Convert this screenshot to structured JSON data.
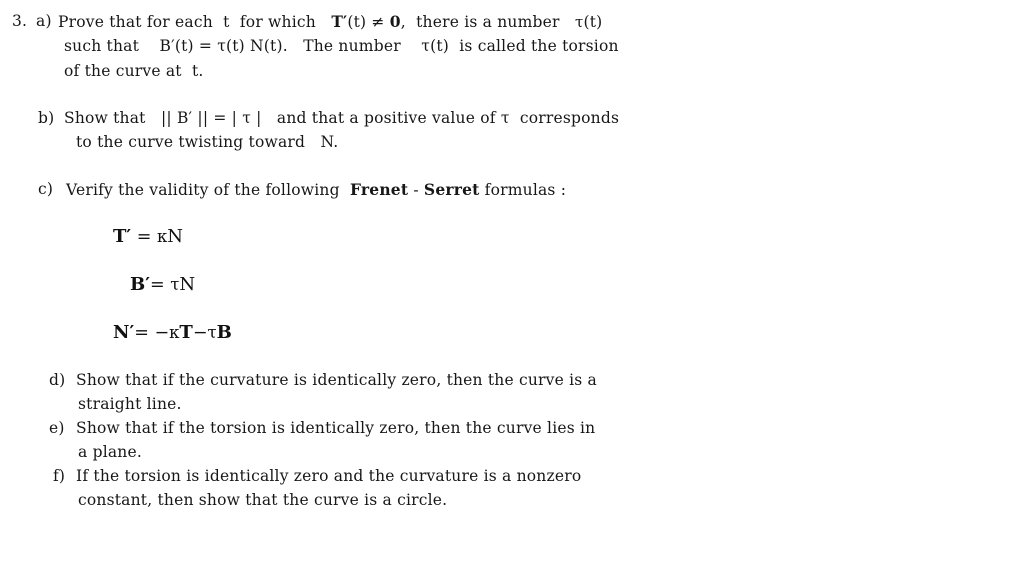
{
  "document": {
    "problem_number": "3.",
    "items": [
      {
        "label": "a)",
        "lines": [
          {
            "id": "a1",
            "segments": [
              {
                "t": "Prove that for each  t  for which   ",
                "style": "plain"
              },
              {
                "t": "T",
                "style": "bold"
              },
              {
                "t": "′",
                "style": "bold"
              },
              {
                "t": "(t) ≠ ",
                "style": "plain"
              },
              {
                "t": "0",
                "style": "bold"
              },
              {
                "t": ",  there is a number   ",
                "style": "plain"
              },
              {
                "t": "τ",
                "style": "greek"
              },
              {
                "t": "(t)",
                "style": "plain"
              }
            ],
            "text": "Prove that for each  t  for which   T′(t) ≠ 0,  there is a number   τ(t)"
          },
          {
            "id": "a2",
            "text": "such that    B′(t) = τ(t) N(t).   The number    τ(t)  is called the torsion"
          },
          {
            "id": "a3",
            "text": "of the curve at  t."
          }
        ]
      },
      {
        "label": "b)",
        "lines": [
          {
            "id": "b1",
            "text": "Show that   || B′ || = | τ |   and that a positive value of τ  corresponds"
          },
          {
            "id": "b2",
            "text": "to the curve twisting toward   N."
          }
        ]
      },
      {
        "label": "c)",
        "lines": [
          {
            "id": "c1",
            "text": "Verify the validity of the following  Frenet - Serret formulas :",
            "bold_terms": [
              "Frenet",
              "Serret"
            ]
          }
        ]
      },
      {
        "label": "d)",
        "lines": [
          {
            "id": "d1",
            "text": "Show that if the curvature is identically zero, then the curve is a"
          },
          {
            "id": "d2",
            "text": "straight line."
          }
        ]
      },
      {
        "label": "e)",
        "lines": [
          {
            "id": "e1",
            "text": "Show that if the torsion is identically zero, then the curve lies in"
          },
          {
            "id": "e2",
            "text": "a plane."
          }
        ]
      },
      {
        "label": "f)",
        "lines": [
          {
            "id": "f1",
            "text": "If the torsion is identically zero and the curvature is a nonzero"
          },
          {
            "id": "f2",
            "text": "constant, then show that the curve is a circle."
          }
        ]
      }
    ],
    "formulas": [
      {
        "id": "formula-1",
        "text": "T′ = κN",
        "lhs": "T′",
        "rhs": "κN"
      },
      {
        "id": "formula-2",
        "text": "B′= τN",
        "lhs": "B′",
        "rhs": "τN"
      },
      {
        "id": "formula-3",
        "text": "N′= −κT−τB",
        "lhs": "N′",
        "rhs": "−κT−τB"
      }
    ],
    "symbols": {
      "tau": "τ",
      "kappa": "κ",
      "prime": "′",
      "not_equal": "≠",
      "norm": "||"
    },
    "colors": {
      "background": "#ffffff",
      "text": "#171717"
    }
  }
}
